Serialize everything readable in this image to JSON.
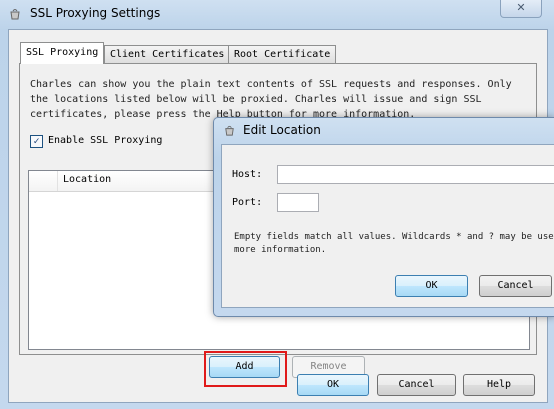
{
  "window": {
    "title": "SSL Proxying Settings",
    "close_glyph": "✕"
  },
  "tabs": [
    {
      "label": "SSL Proxying",
      "active": true
    },
    {
      "label": "Client Certificates",
      "active": false
    },
    {
      "label": "Root Certificate",
      "active": false
    }
  ],
  "ssl_proxying": {
    "description": "Charles can show you the plain text contents of SSL requests and responses. Only the locations listed below will be proxied. Charles will issue and sign SSL certificates, please press the Help button for more information.",
    "enable_label": "Enable SSL Proxying",
    "enable_checked": true,
    "check_glyph": "✓",
    "table": {
      "columns": [
        "",
        "Location"
      ],
      "rows": []
    },
    "add_label": "Add",
    "remove_label": "Remove"
  },
  "footer": {
    "ok_label": "OK",
    "cancel_label": "Cancel",
    "help_label": "Help"
  },
  "edit_location_dialog": {
    "title": "Edit Location",
    "host_label": "Host:",
    "host_value": "",
    "port_label": "Port:",
    "port_value": "",
    "description": "Empty fields match all values. Wildcards * and ? may be used. See more information.",
    "ok_label": "OK",
    "cancel_label": "Cancel"
  },
  "icons": {
    "app": "charles-pot-icon",
    "close": "close-icon",
    "checkbox": "check-icon"
  },
  "colors": {
    "highlight": "#e01a1a",
    "title_bar": "#c4d8ee",
    "panel": "#f0f0f0"
  }
}
